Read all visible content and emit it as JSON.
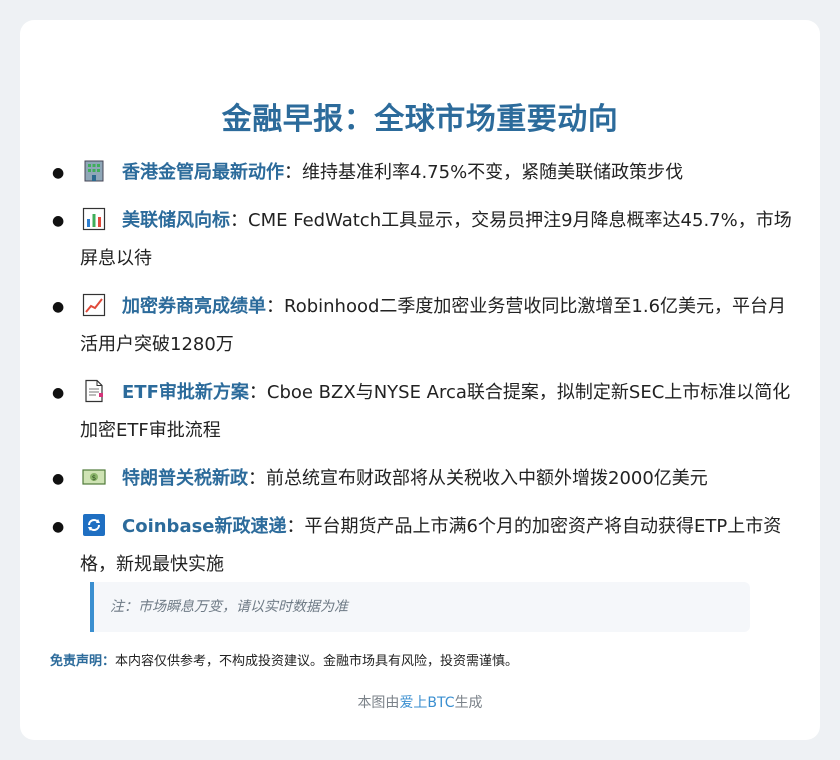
{
  "title": "金融早报：全球市场重要动向",
  "items": [
    {
      "icon": "office-building-icon",
      "headline": "香港金管局最新动作",
      "separator": "：",
      "body": "维持基准利率4.75%不变，紧随美联储政策步伐"
    },
    {
      "icon": "bar-chart-icon",
      "headline": "美联储风向标",
      "separator": "：",
      "body": "CME FedWatch工具显示，交易员押注9月降息概率达45.7%，市场屏息以待"
    },
    {
      "icon": "chart-increasing-icon",
      "headline": "加密券商亮成绩单",
      "separator": "：",
      "body": "Robinhood二季度加密业务营收同比激增至1.6亿美元，平台月活用户突破1280万"
    },
    {
      "icon": "document-icon",
      "headline": "ETF审批新方案",
      "separator": "：",
      "body": "Cboe BZX与NYSE Arca联合提案，拟制定新SEC上市标准以简化加密ETF审批流程"
    },
    {
      "icon": "dollar-banknote-icon",
      "headline": "特朗普关税新政",
      "separator": "：",
      "body": "前总统宣布财政部将从关税收入中额外增拨2000亿美元"
    },
    {
      "icon": "refresh-arrows-icon",
      "headline": "Coinbase新政速递",
      "separator": "：",
      "body": "平台期货产品上市满6个月的加密资产将自动获得ETP上市资格，新规最快实施"
    }
  ],
  "note": "注：市场瞬息万变，请以实时数据为准",
  "disclaimer": {
    "label": "免责声明：",
    "text": "本内容仅供参考，不构成投资建议。金融市场具有风险，投资需谨慎。"
  },
  "footer": {
    "prefix": "本图由",
    "link": "爱上BTC",
    "suffix": "生成"
  },
  "colors": {
    "accent": "#2c6b9b",
    "note_border": "#3b8fd0",
    "background": "#eef1f4"
  }
}
